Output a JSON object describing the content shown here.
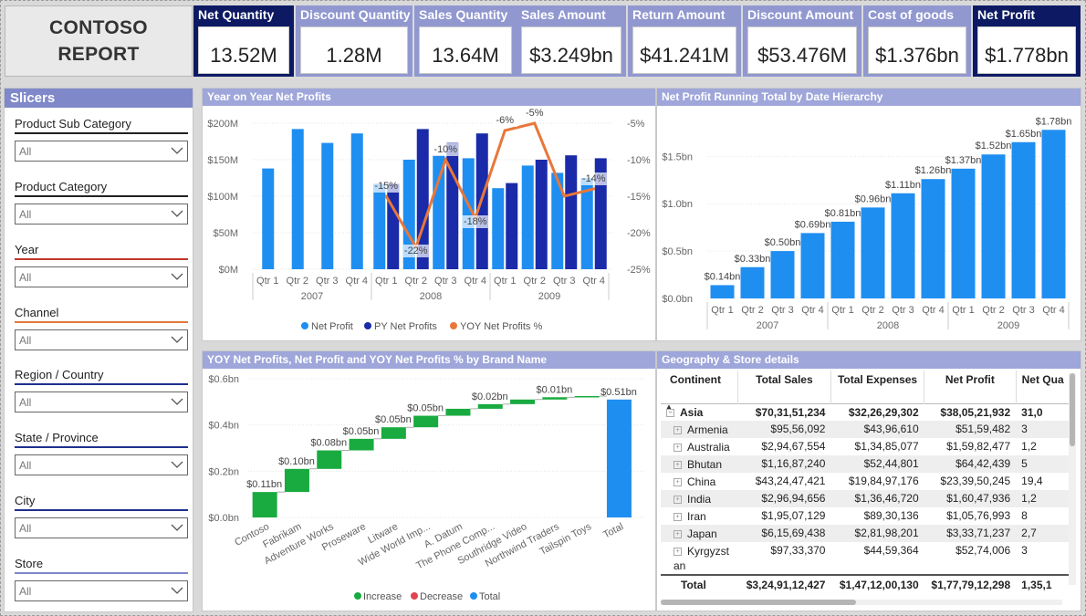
{
  "title": {
    "line1": "CONTOSO",
    "line2": "REPORT"
  },
  "kpis": [
    {
      "label": "Net Quantity",
      "value": "13.52M",
      "dark": true
    },
    {
      "label": "Discount Quantity",
      "value": "1.28M",
      "dark": false
    },
    {
      "label": "Sales Quantity",
      "value": "13.64M",
      "dark": false
    },
    {
      "label": "Sales Amount",
      "value": "$3.249bn",
      "dark": false
    },
    {
      "label": "Return Amount",
      "value": "$41.241M",
      "dark": false
    },
    {
      "label": "Discount Amount",
      "value": "$53.476M",
      "dark": false
    },
    {
      "label": "Cost of goods",
      "value": "$1.376bn",
      "dark": false
    },
    {
      "label": "Net Profit",
      "value": "$1.778bn",
      "dark": true
    }
  ],
  "slicers": {
    "header": "Slicers",
    "items": [
      {
        "label": "Product Sub Category",
        "value": "All",
        "color": "#222222"
      },
      {
        "label": "Product Category",
        "value": "All",
        "color": "#222222"
      },
      {
        "label": "Year",
        "value": "All",
        "color": "#c0392b"
      },
      {
        "label": "Channel",
        "value": "All",
        "color": "#e07b39"
      },
      {
        "label": "Region / Country",
        "value": "All",
        "color": "#1f2f8f"
      },
      {
        "label": "State / Province",
        "value": "All",
        "color": "#1f2f8f"
      },
      {
        "label": "City",
        "value": "All",
        "color": "#1f2f8f"
      },
      {
        "label": "Store",
        "value": "All",
        "color": "#7f88c9"
      }
    ]
  },
  "panels": {
    "yoy": "Year on Year Net Profits",
    "running": "Net Profit Running Total by Date Hierarchy",
    "brand": "YOY Net Profits, Net Profit and YOY Net Profits % by Brand Name",
    "geo": "Geography & Store details"
  },
  "colors": {
    "light_blue": "#1f8ef1",
    "dark_blue": "#1a2aa8",
    "orange": "#e8773a",
    "green": "#1aab40",
    "red": "#e0454f"
  },
  "chart_data": [
    {
      "type": "bar",
      "title": "Year on Year Net Profits",
      "categories": [
        "Qtr 1",
        "Qtr 2",
        "Qtr 3",
        "Qtr 4",
        "Qtr 1",
        "Qtr 2",
        "Qtr 3",
        "Qtr 4",
        "Qtr 1",
        "Qtr 2",
        "Qtr 3",
        "Qtr 4"
      ],
      "groups": [
        "2007",
        "2008",
        "2009"
      ],
      "y_ticks": [
        "$0M",
        "$50M",
        "$100M",
        "$150M",
        "$200M"
      ],
      "y2_ticks": [
        "-25%",
        "-20%",
        "-15%",
        "-10%",
        "-5%"
      ],
      "ylim": [
        0,
        200
      ],
      "y2lim": [
        -25,
        -5
      ],
      "series": [
        {
          "name": "Net Profit",
          "kind": "bar",
          "color": "#1f8ef1",
          "values": [
            138,
            192,
            173,
            186,
            117,
            150,
            156,
            152,
            111,
            142,
            132,
            125
          ]
        },
        {
          "name": "PY Net Profit",
          "kind": "bar",
          "color": "#1a2aa8",
          "values": [
            null,
            null,
            null,
            null,
            117,
            192,
            173,
            186,
            118,
            150,
            156,
            152
          ]
        },
        {
          "name": "YOY Net Profits %",
          "kind": "line",
          "color": "#e8773a",
          "values": [
            null,
            null,
            null,
            null,
            -15,
            -22,
            -10,
            -18,
            -6,
            -5,
            -15,
            -14
          ]
        }
      ],
      "data_labels": [
        "",
        "",
        "",
        "",
        "-15%",
        "-22%",
        "-10%",
        "-18%",
        "-6%",
        "-5%",
        "",
        "-14%"
      ],
      "legend": [
        "Net Profit",
        "PY Net Profits",
        "YOY Net Profits %"
      ],
      "legend_position": "bottom"
    },
    {
      "type": "bar",
      "title": "Net Profit Running Total by Date Hierarchy",
      "categories": [
        "Qtr 1",
        "Qtr 2",
        "Qtr 3",
        "Qtr 4",
        "Qtr 1",
        "Qtr 2",
        "Qtr 3",
        "Qtr 4",
        "Qtr 1",
        "Qtr 2",
        "Qtr 3",
        "Qtr 4"
      ],
      "groups": [
        "2007",
        "2008",
        "2009"
      ],
      "values": [
        0.14,
        0.33,
        0.5,
        0.69,
        0.81,
        0.96,
        1.11,
        1.26,
        1.37,
        1.52,
        1.65,
        1.78
      ],
      "labels": [
        "$0.14bn",
        "$0.33bn",
        "$0.50bn",
        "$0.69bn",
        "$0.81bn",
        "$0.96bn",
        "$1.11bn",
        "$1.26bn",
        "$1.37bn",
        "$1.52bn",
        "$1.65bn",
        "$1.78bn"
      ],
      "y_ticks": [
        "$0.0bn",
        "$0.5bn",
        "$1.0bn",
        "$1.5bn"
      ],
      "ylim": [
        0,
        1.85
      ]
    },
    {
      "type": "bar",
      "subtype": "waterfall",
      "title": "YOY Net Profits, Net Profit and YOY Net Profits % by Brand Name",
      "categories": [
        "Contoso",
        "Fabrikam",
        "Adventure Works",
        "Proseware",
        "Litware",
        "Wide World Imp...",
        "A. Datum",
        "The Phone Comp...",
        "Southridge Video",
        "Northwind Traders",
        "Tailspin Toys",
        "Total"
      ],
      "values": [
        0.11,
        0.1,
        0.08,
        0.05,
        0.05,
        0.05,
        0.03,
        0.02,
        0.02,
        0.01,
        0.005,
        0.51
      ],
      "labels": [
        "$0.11bn",
        "$0.10bn",
        "$0.08bn",
        "$0.05bn",
        "$0.05bn",
        "$0.05bn",
        "",
        "$0.02bn",
        "",
        "$0.01bn",
        "",
        "$0.51bn"
      ],
      "y_ticks": [
        "$0.0bn",
        "$0.2bn",
        "$0.4bn",
        "$0.6bn"
      ],
      "ylim": [
        0,
        0.6
      ],
      "legend": [
        "Increase",
        "Decrease",
        "Total"
      ],
      "legend_position": "bottom"
    }
  ],
  "geo_table": {
    "columns": [
      "Continent",
      "Total Sales",
      "Total Expenses",
      "Net Profit",
      "Net Qua"
    ],
    "group": {
      "name": "Asia",
      "values": [
        "$70,31,51,234",
        "$32,26,29,302",
        "$38,05,21,932",
        "31,0"
      ]
    },
    "rows": [
      {
        "name": "Armenia",
        "values": [
          "$95,56,092",
          "$43,96,610",
          "$51,59,482",
          "3"
        ]
      },
      {
        "name": "Australia",
        "values": [
          "$2,94,67,554",
          "$1,34,85,077",
          "$1,59,82,477",
          "1,2"
        ]
      },
      {
        "name": "Bhutan",
        "values": [
          "$1,16,87,240",
          "$52,44,801",
          "$64,42,439",
          "5"
        ]
      },
      {
        "name": "China",
        "values": [
          "$43,24,47,421",
          "$19,84,97,176",
          "$23,39,50,245",
          "19,4"
        ]
      },
      {
        "name": "India",
        "values": [
          "$2,96,94,656",
          "$1,36,46,720",
          "$1,60,47,936",
          "1,2"
        ]
      },
      {
        "name": "Iran",
        "values": [
          "$1,95,07,129",
          "$89,30,136",
          "$1,05,76,993",
          "8"
        ]
      },
      {
        "name": "Japan",
        "values": [
          "$6,15,69,438",
          "$2,81,98,201",
          "$3,33,71,237",
          "2,7"
        ]
      },
      {
        "name": "Kyrgyzst an",
        "values": [
          "$97,33,370",
          "$44,59,364",
          "$52,74,006",
          "3"
        ]
      }
    ],
    "total": {
      "name": "Total",
      "values": [
        "$3,24,91,12,427",
        "$1,47,12,00,130",
        "$1,77,79,12,298",
        "1,35,1"
      ]
    }
  }
}
